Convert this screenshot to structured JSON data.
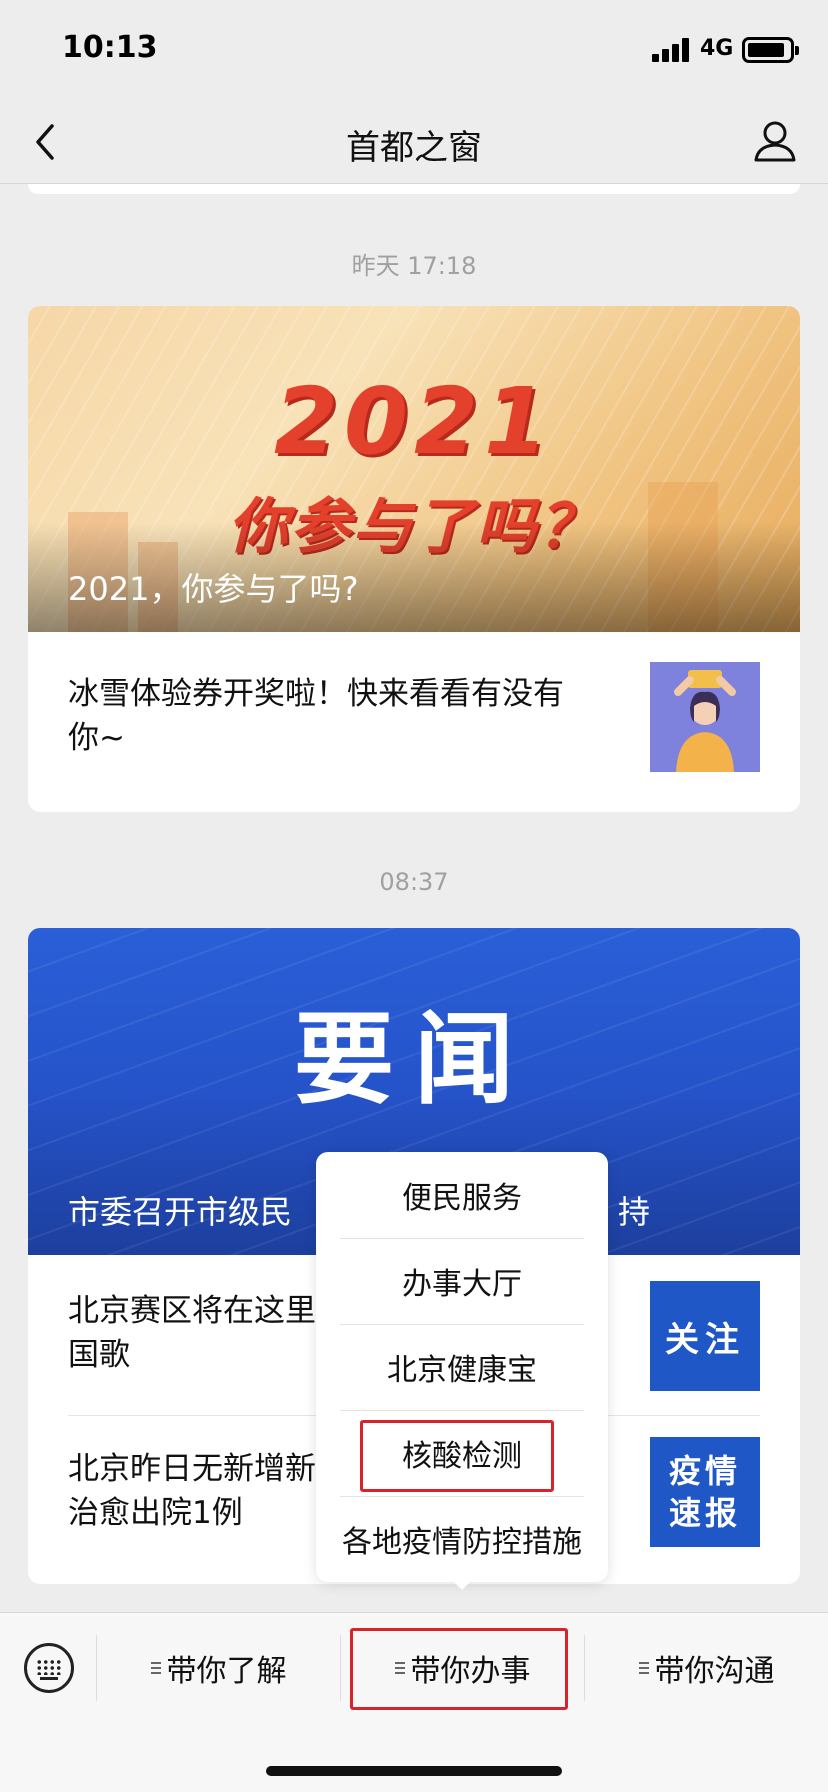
{
  "status_bar": {
    "time": "10:13",
    "network": "4G"
  },
  "nav": {
    "title": "首都之窗"
  },
  "messages": [
    {
      "timestamp": "昨天 17:18",
      "banner_title_line1": "2021",
      "banner_title_line2": "你参与了吗？",
      "banner_caption": "2021，你参与了吗?",
      "articles": [
        {
          "title_line1": "冰雪体验券开奖啦！快来看看有没有",
          "title_line2": "你~"
        }
      ]
    },
    {
      "timestamp": "08:37",
      "banner_title": "要闻",
      "banner_caption_visible": "市委召开市级民",
      "banner_caption_tail": "持",
      "articles": [
        {
          "title_line1": "北京赛区将在这里",
          "title_line2": "国歌",
          "thumb_text_line1": "关注"
        },
        {
          "title_line1": "北京昨日无新增新",
          "title_line2": "治愈出院1例",
          "thumb_text_line1": "疫情",
          "thumb_text_line2": "速报"
        }
      ]
    }
  ],
  "popup_menu": {
    "items": [
      "便民服务",
      "办事大厅",
      "北京健康宝",
      "核酸检测",
      "各地疫情防控措施"
    ],
    "highlighted_item": "核酸检测"
  },
  "bottom_menu": {
    "tabs": [
      "带你了解",
      "带你办事",
      "带你沟通"
    ],
    "highlighted_tab": "带你办事"
  },
  "colors": {
    "highlight": "#d7242c",
    "news_blue": "#2553c9",
    "banner_red": "#e3412c"
  },
  "icons": {
    "back": "chevron-left-icon",
    "profile": "person-icon",
    "keyboard": "keyboard-icon"
  }
}
